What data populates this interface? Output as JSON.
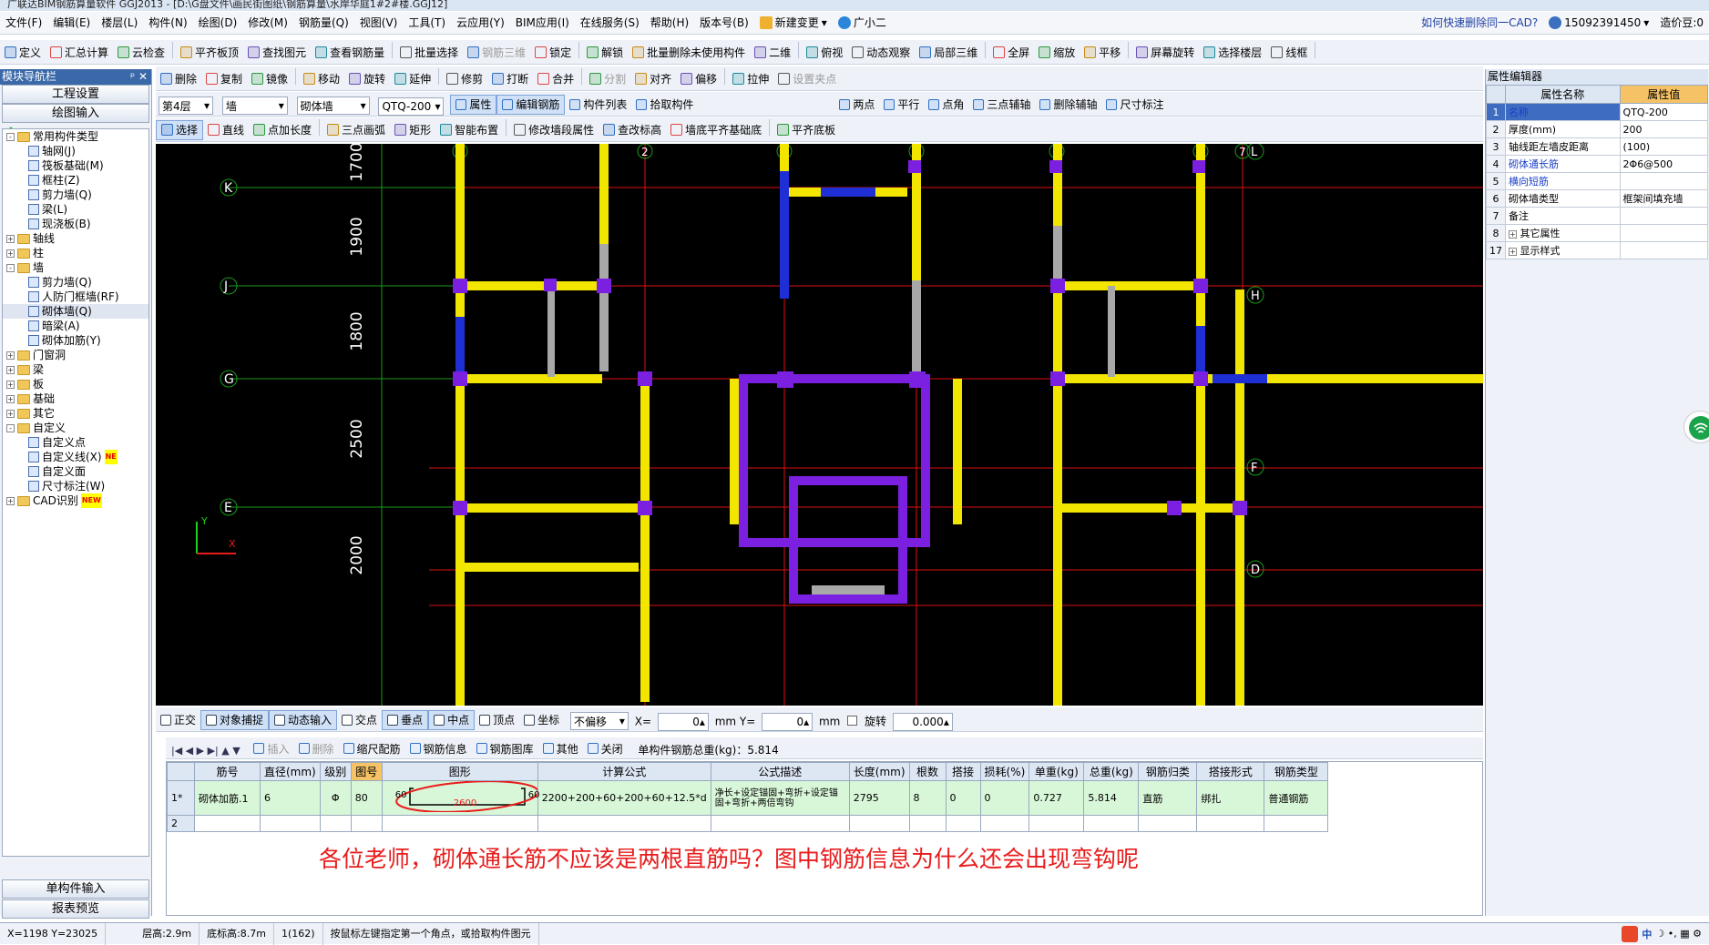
{
  "title": "广联达BIM钢筋算量软件 GGJ2013 - [D:\\G盘文件\\画民街图纸\\钢筋算量\\水岸华庭1#2#楼.GGJ12]",
  "menu": {
    "items": [
      "文件(F)",
      "编辑(E)",
      "楼层(L)",
      "构件(N)",
      "绘图(D)",
      "修改(M)",
      "钢筋量(Q)",
      "视图(V)",
      "工具(T)",
      "云应用(Y)",
      "BIM应用(I)",
      "在线服务(S)",
      "帮助(H)",
      "版本号(B)"
    ],
    "new_change": "新建变更",
    "guangxiaoer": "广小二",
    "tip": "如何快速删除同一CAD?",
    "phone": "15092391450",
    "price": "造价豆:0"
  },
  "toolbar1": [
    "定义",
    "汇总计算",
    "云检查",
    "平齐板顶",
    "查找图元",
    "查看钢筋量",
    "批量选择",
    "钢筋三维",
    "锁定",
    "解锁",
    "批量删除未使用构件",
    "二维",
    "俯视",
    "动态观察",
    "局部三维",
    "全屏",
    "缩放",
    "平移",
    "屏幕旋转",
    "选择楼层",
    "线框"
  ],
  "toolbar2": [
    "删除",
    "复制",
    "镜像",
    "移动",
    "旋转",
    "延伸",
    "修剪",
    "打断",
    "合并",
    "分割",
    "对齐",
    "偏移",
    "拉伸",
    "设置夹点"
  ],
  "toolbar3": {
    "floor": "第4层",
    "type": "墙",
    "subtype": "砌体墙",
    "component": "QTQ-200",
    "buttons": [
      "属性",
      "编辑钢筋",
      "构件列表",
      "拾取构件",
      "两点",
      "平行",
      "点角",
      "三点辅轴",
      "删除辅轴",
      "尺寸标注"
    ]
  },
  "toolbar4": [
    "选择",
    "直线",
    "点加长度",
    "三点画弧",
    "矩形",
    "智能布置",
    "修改墙段属性",
    "查改标高",
    "墙底平齐基础底",
    "平齐底板"
  ],
  "nav": {
    "header": "模块导航栏",
    "btn_project": "工程设置",
    "btn_draw": "绘图输入",
    "tree": [
      {
        "label": "常用构件类型",
        "level": 0,
        "exp": "-",
        "kind": "folder"
      },
      {
        "label": "轴网(J)",
        "level": 2,
        "kind": "leaf"
      },
      {
        "label": "筏板基础(M)",
        "level": 2,
        "kind": "leaf"
      },
      {
        "label": "框柱(Z)",
        "level": 2,
        "kind": "leaf"
      },
      {
        "label": "剪力墙(Q)",
        "level": 2,
        "kind": "leaf"
      },
      {
        "label": "梁(L)",
        "level": 2,
        "kind": "leaf"
      },
      {
        "label": "现浇板(B)",
        "level": 2,
        "kind": "leaf"
      },
      {
        "label": "轴线",
        "level": 0,
        "exp": "+",
        "kind": "folder"
      },
      {
        "label": "柱",
        "level": 0,
        "exp": "+",
        "kind": "folder"
      },
      {
        "label": "墙",
        "level": 0,
        "exp": "-",
        "kind": "folder"
      },
      {
        "label": "剪力墙(Q)",
        "level": 2,
        "kind": "leaf"
      },
      {
        "label": "人防门框墙(RF)",
        "level": 2,
        "kind": "leaf"
      },
      {
        "label": "砌体墙(Q)",
        "level": 2,
        "kind": "leaf"
      },
      {
        "label": "暗梁(A)",
        "level": 2,
        "kind": "leaf"
      },
      {
        "label": "砌体加筋(Y)",
        "level": 2,
        "kind": "leaf"
      },
      {
        "label": "门窗洞",
        "level": 0,
        "exp": "+",
        "kind": "folder"
      },
      {
        "label": "梁",
        "level": 0,
        "exp": "+",
        "kind": "folder"
      },
      {
        "label": "板",
        "level": 0,
        "exp": "+",
        "kind": "folder"
      },
      {
        "label": "基础",
        "level": 0,
        "exp": "+",
        "kind": "folder"
      },
      {
        "label": "其它",
        "level": 0,
        "exp": "+",
        "kind": "folder"
      },
      {
        "label": "自定义",
        "level": 0,
        "exp": "-",
        "kind": "folder"
      },
      {
        "label": "自定义点",
        "level": 2,
        "kind": "leaf"
      },
      {
        "label": "自定义线(X)",
        "level": 2,
        "kind": "leaf",
        "new": "NE"
      },
      {
        "label": "自定义面",
        "level": 2,
        "kind": "leaf"
      },
      {
        "label": "尺寸标注(W)",
        "level": 2,
        "kind": "leaf"
      },
      {
        "label": "CAD识别",
        "level": 0,
        "exp": "+",
        "kind": "folder",
        "new": "NEW"
      }
    ],
    "btn_single": "单构件输入",
    "btn_report": "报表预览"
  },
  "canvas": {
    "dims": [
      "1700",
      "1900",
      "1800",
      "2500",
      "2000"
    ],
    "row_axes": [
      "K",
      "J",
      "G",
      "E"
    ],
    "col_axes": [
      "1",
      "2",
      "3",
      "4",
      "5",
      "6",
      "7"
    ],
    "right_axes": [
      "L",
      "H",
      "F",
      "D"
    ]
  },
  "snapbar": {
    "buttons": [
      "正交",
      "对象捕捉",
      "动态输入",
      "交点",
      "垂点",
      "中点",
      "顶点",
      "坐标"
    ],
    "offset_mode": "不偏移",
    "x_label": "X=",
    "x_value": "0",
    "y_label": "mm Y=",
    "y_value": "0",
    "mm": "mm",
    "rotate_label": "旋转",
    "rotate_value": "0.000"
  },
  "rebarbar": {
    "buttons": [
      "插入",
      "删除",
      "缩尺配筋",
      "钢筋信息",
      "钢筋图库",
      "其他",
      "关闭"
    ],
    "total": "单构件钢筋总重(kg)：5.814"
  },
  "rebar_table": {
    "headers": [
      "筋号",
      "直径(mm)",
      "级别",
      "图号",
      "图形",
      "计算公式",
      "公式描述",
      "长度(mm)",
      "根数",
      "搭接",
      "损耗(%)",
      "单重(kg)",
      "总重(kg)",
      "钢筋归类",
      "搭接形式",
      "钢筋类型"
    ],
    "row1": {
      "idx": "1*",
      "name": "砌体加筋.1",
      "diameter": "6",
      "grade": "Φ",
      "fig": "80",
      "shape_left": "60",
      "shape_mid": "2600",
      "shape_right": "60",
      "formula": "2200+200+60+200+60+12.5*d",
      "desc": "净长+设定锚固+弯折+设定锚固+弯折+两倍弯钩",
      "length": "2795",
      "count": "8",
      "lap": "0",
      "loss": "0",
      "unit_w": "0.727",
      "total_w": "5.814",
      "category": "直筋",
      "lap_form": "绑扎",
      "rebar_type": "普通钢筋"
    },
    "row2_idx": "2"
  },
  "question": "各位老师，砌体通长筋不应该是两根直筋吗？图中钢筋信息为什么还会出现弯钩呢",
  "props": {
    "header": "属性编辑器",
    "col_name": "属性名称",
    "col_value": "属性值",
    "rows": [
      {
        "n": "1",
        "k": "名称",
        "v": "QTQ-200",
        "blue": true
      },
      {
        "n": "2",
        "k": "厚度(mm)",
        "v": "200"
      },
      {
        "n": "3",
        "k": "轴线距左墙皮距离",
        "v": "(100)"
      },
      {
        "n": "4",
        "k": "砌体通长筋",
        "v": "2Φ6@500",
        "blue": true
      },
      {
        "n": "5",
        "k": "横向短筋",
        "v": "",
        "blue": true
      },
      {
        "n": "6",
        "k": "砌体墙类型",
        "v": "框架间填充墙"
      },
      {
        "n": "7",
        "k": "备注",
        "v": ""
      },
      {
        "n": "8",
        "k": "其它属性",
        "v": "",
        "exp": "+"
      },
      {
        "n": "17",
        "k": "显示样式",
        "v": "",
        "exp": "+"
      }
    ]
  },
  "status": {
    "coords": "X=1198 Y=23025",
    "floor_h": "层高:2.9m",
    "bottom_h": "底标高:8.7m",
    "count": "1(162)",
    "hint": "按鼠标左键指定第一个角点，或拾取构件图元"
  },
  "ime": "中"
}
